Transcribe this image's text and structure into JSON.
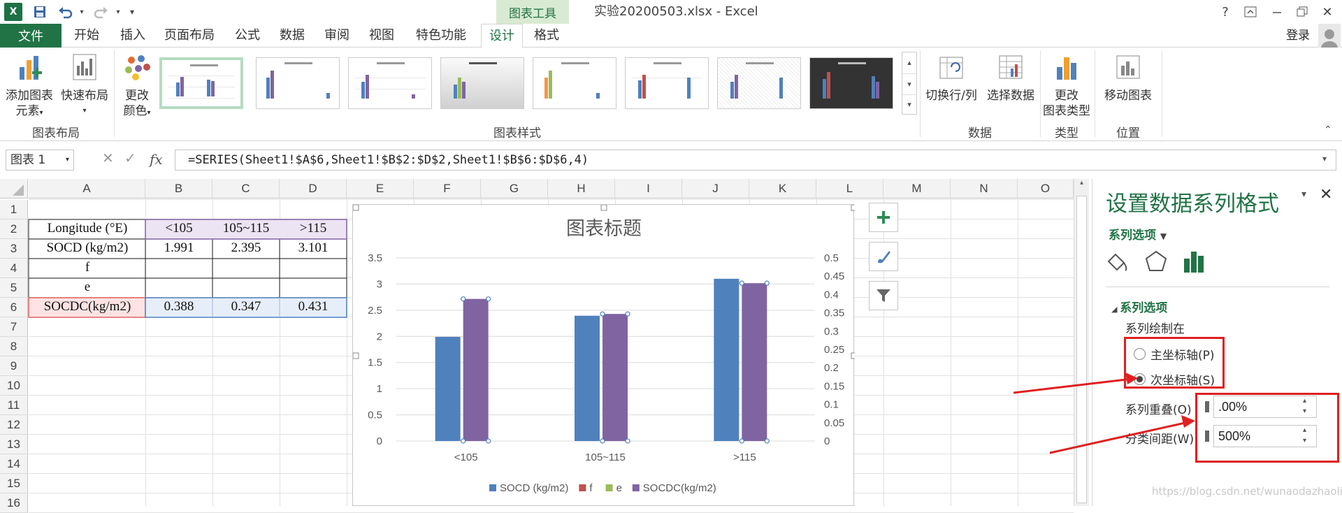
{
  "window": {
    "contextual_tab_group": "图表工具",
    "title": "实验20200503.xlsx - Excel",
    "help": "?",
    "user": "登录"
  },
  "tabs": [
    "文件",
    "开始",
    "插入",
    "页面布局",
    "公式",
    "数据",
    "审阅",
    "视图",
    "特色功能",
    "设计",
    "格式"
  ],
  "active_tab": "设计",
  "ribbon": {
    "add_element_1": "添加图表",
    "add_element_2": "元素",
    "quick_layout": "快速布局",
    "change_color_1": "更改",
    "change_color_2": "颜色",
    "group_layout": "图表布局",
    "group_styles": "图表样式",
    "switch_rowcol": "切换行/列",
    "select_data": "选择数据",
    "group_data": "数据",
    "change_type_1": "更改",
    "change_type_2": "图表类型",
    "group_type": "类型",
    "move_chart": "移动图表",
    "group_location": "位置"
  },
  "formula_bar": {
    "name_box": "图表 1",
    "fx": "fx",
    "formula": "=SERIES(Sheet1!$A$6,Sheet1!$B$2:$D$2,Sheet1!$B$6:$D$6,4)"
  },
  "columns": [
    "A",
    "B",
    "C",
    "D",
    "E",
    "F",
    "G",
    "H",
    "I",
    "J",
    "K",
    "L",
    "M",
    "N",
    "O"
  ],
  "rows": [
    "1",
    "2",
    "3",
    "4",
    "5",
    "6",
    "7",
    "8",
    "9",
    "10",
    "11",
    "12",
    "13",
    "14",
    "15",
    "16"
  ],
  "cells": {
    "a2": "Longitude (°E)",
    "b2": "<105",
    "c2": "105~115",
    "d2": ">115",
    "a3": "SOCD (kg/m2)",
    "b3": "1.991",
    "c3": "2.395",
    "d3": "3.101",
    "a4": "f",
    "a5": "e",
    "a6": "SOCDC(kg/m2)",
    "b6": "0.388",
    "c6": "0.347",
    "d6": "0.431"
  },
  "chart_data": {
    "type": "bar",
    "title": "图表标题",
    "categories": [
      "<105",
      "105~115",
      ">115"
    ],
    "series": [
      {
        "name": "SOCD (kg/m2)",
        "values": [
          1.991,
          2.395,
          3.101
        ],
        "color": "#4f81bd",
        "axis": "primary"
      },
      {
        "name": "f",
        "values": [],
        "color": "#c0504d",
        "axis": "primary"
      },
      {
        "name": "e",
        "values": [],
        "color": "#9bbb59",
        "axis": "primary"
      },
      {
        "name": "SOCDC(kg/m2)",
        "values": [
          0.388,
          0.347,
          0.431
        ],
        "color": "#8064a2",
        "axis": "secondary"
      }
    ],
    "ylim": [
      0,
      3.5
    ],
    "yticks": [
      "0",
      "0.5",
      "1",
      "1.5",
      "2",
      "2.5",
      "3",
      "3.5"
    ],
    "y2lim": [
      0,
      0.5
    ],
    "y2ticks": [
      "0",
      "0.05",
      "0.1",
      "0.15",
      "0.2",
      "0.25",
      "0.3",
      "0.35",
      "0.4",
      "0.45",
      "0.5"
    ],
    "legend": "bottom",
    "grid": true
  },
  "pane": {
    "title": "设置数据系列格式",
    "series_options_dropdown": "系列选项",
    "section": "系列选项",
    "plot_on": "系列绘制在",
    "primary_axis": "主坐标轴(P)",
    "secondary_axis": "次坐标轴(S)",
    "overlap_label": "系列重叠(O)",
    "overlap_value": ".00%",
    "gap_label": "分类间距(W)",
    "gap_value": "500%"
  },
  "watermark": "https://blog.csdn.net/wunaodazhaoliu",
  "colors": {
    "excel_green": "#217346",
    "highlight_red": "#e02020"
  }
}
